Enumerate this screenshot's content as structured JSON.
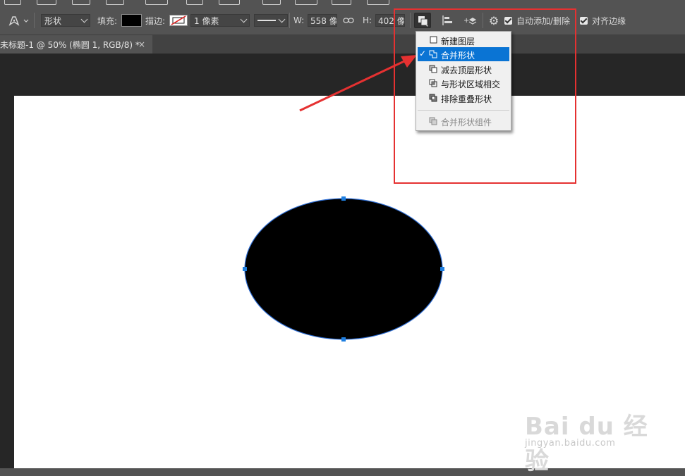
{
  "options_bar": {
    "mode": "形状",
    "fill_label": "填充:",
    "fill_color": "#000000",
    "stroke_label": "描边:",
    "stroke_width": "1 像素",
    "width_label": "W:",
    "width_value": "558 像",
    "height_label": "H:",
    "height_value": "402 像",
    "auto_add_delete": "自动添加/删除",
    "align_edges": "对齐边缘"
  },
  "document_tab": {
    "title": "未标题-1 @ 50% (椭圆 1, RGB/8) *",
    "close": "×"
  },
  "path_ops_menu": {
    "items": [
      {
        "label": "新建图层",
        "selected": false,
        "disabled": false,
        "icon": "new-layer-icon"
      },
      {
        "label": "合并形状",
        "selected": true,
        "disabled": false,
        "icon": "combine-shapes-icon"
      },
      {
        "label": "减去顶层形状",
        "selected": false,
        "disabled": false,
        "icon": "subtract-front-shape-icon"
      },
      {
        "label": "与形状区域相交",
        "selected": false,
        "disabled": false,
        "icon": "intersect-shape-areas-icon"
      },
      {
        "label": "排除重叠形状",
        "selected": false,
        "disabled": false,
        "icon": "exclude-overlapping-shapes-icon"
      },
      {
        "label": "合并形状组件",
        "selected": false,
        "disabled": true,
        "icon": "merge-shape-components-icon"
      }
    ],
    "check_mark": "✓"
  },
  "ellipse": {
    "fill": "#000000",
    "stroke": "#2f6fd6"
  },
  "colors": {
    "annotation_red": "#e53131",
    "menu_selected": "#0a74d4",
    "anchor_blue": "#1e7fe0"
  },
  "watermark": {
    "brand": "Bai du 经验",
    "url": "jingyan.baidu.com"
  }
}
